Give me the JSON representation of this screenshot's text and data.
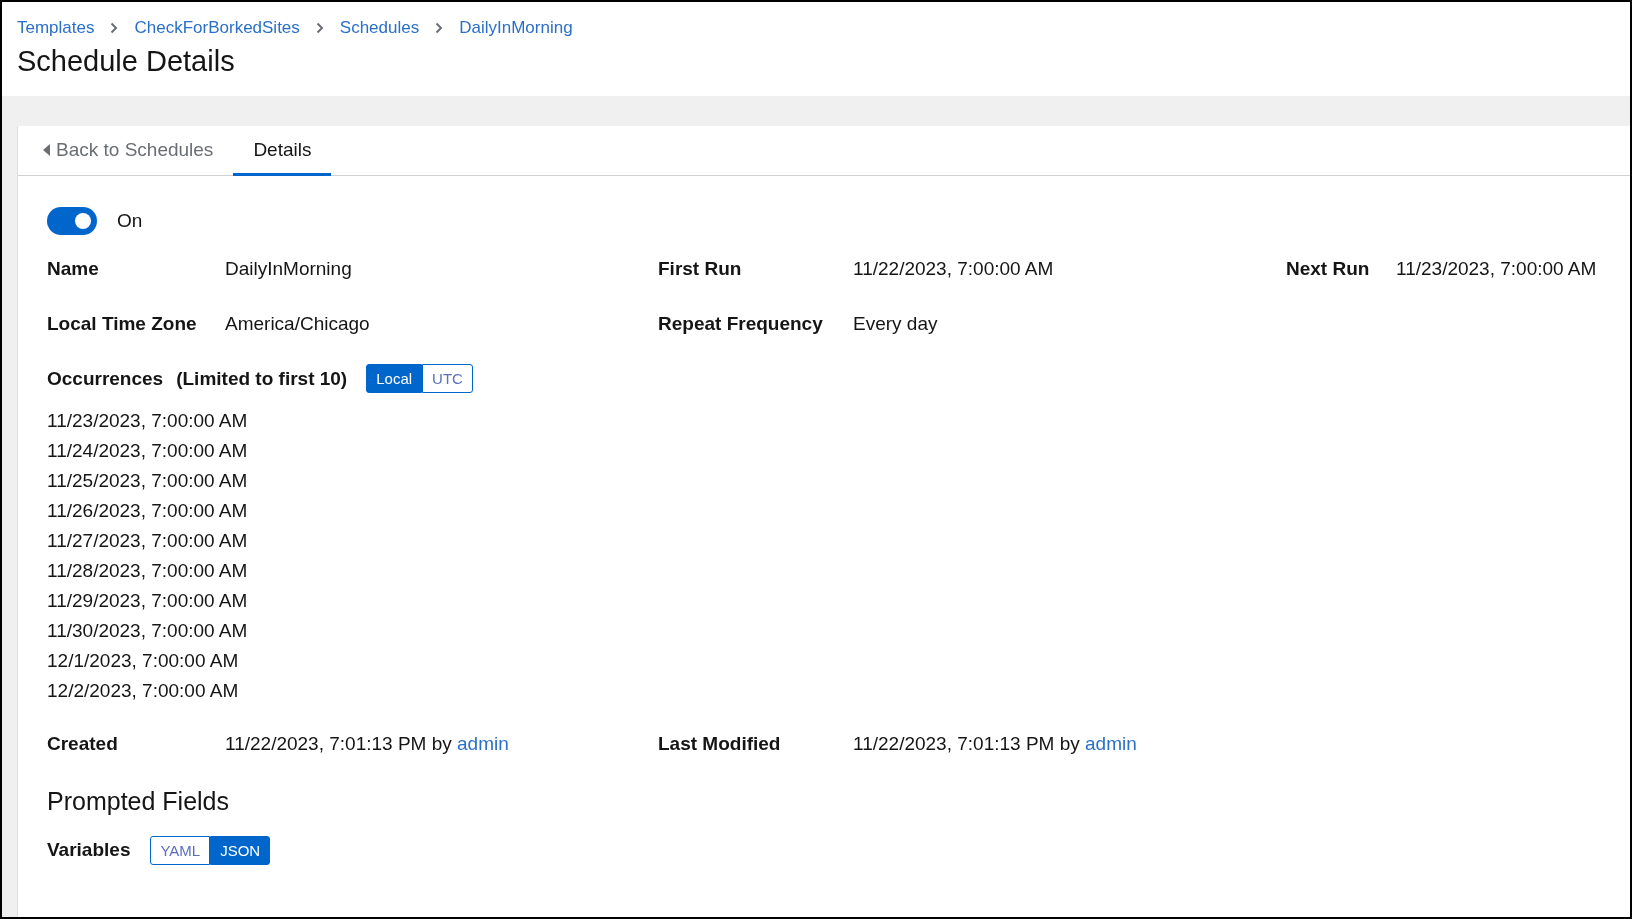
{
  "breadcrumbs": [
    {
      "label": "Templates"
    },
    {
      "label": "CheckForBorkedSites"
    },
    {
      "label": "Schedules"
    },
    {
      "label": "DailyInMorning"
    }
  ],
  "title": "Schedule Details",
  "tabs": [
    {
      "label": "Back to Schedules",
      "kind": "back",
      "selected": false
    },
    {
      "label": "Details",
      "kind": "tab",
      "selected": true
    }
  ],
  "toggle": {
    "on": true,
    "label": "On"
  },
  "detail_rows": [
    [
      {
        "label": "Name",
        "value": "DailyInMorning"
      },
      {
        "label": "First Run",
        "value": "11/22/2023, 7:00:00 AM"
      },
      {
        "label": "Next Run",
        "value": "11/23/2023, 7:00:00 AM"
      }
    ],
    [
      {
        "label": "Local Time Zone",
        "value": "America/Chicago"
      },
      {
        "label": "Repeat Frequency",
        "value": "Every day"
      }
    ]
  ],
  "occurrences": {
    "label": "Occurrences",
    "note": "(Limited to first 10)",
    "modes": [
      {
        "label": "Local",
        "selected": true
      },
      {
        "label": "UTC",
        "selected": false
      }
    ],
    "items": [
      "11/23/2023, 7:00:00 AM",
      "11/24/2023, 7:00:00 AM",
      "11/25/2023, 7:00:00 AM",
      "11/26/2023, 7:00:00 AM",
      "11/27/2023, 7:00:00 AM",
      "11/28/2023, 7:00:00 AM",
      "11/29/2023, 7:00:00 AM",
      "11/30/2023, 7:00:00 AM",
      "12/1/2023, 7:00:00 AM",
      "12/2/2023, 7:00:00 AM"
    ]
  },
  "audit": [
    {
      "label": "Created",
      "value": "11/22/2023, 7:01:13 PM by",
      "user": "admin"
    },
    {
      "label": "Last Modified",
      "value": "11/22/2023, 7:01:13 PM by",
      "user": "admin"
    }
  ],
  "prompted": {
    "heading": "Prompted Fields",
    "variables": {
      "label": "Variables",
      "modes": [
        {
          "label": "YAML",
          "selected": false
        },
        {
          "label": "JSON",
          "selected": true
        }
      ]
    }
  }
}
